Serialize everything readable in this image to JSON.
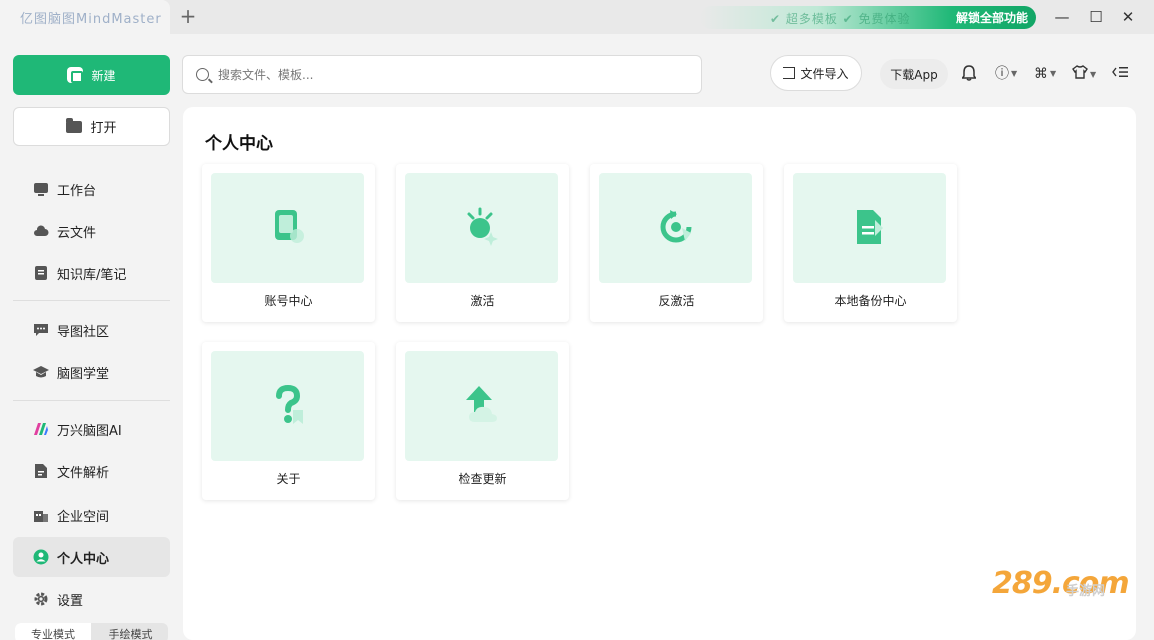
{
  "titlebar": {
    "tab_title": "亿图脑图MindMaster",
    "promo_faded": "✔ 超多模板 ✔ 免费体验",
    "promo_cta": "解锁全部功能",
    "add_tab": "+",
    "minimize": "—",
    "maximize": "☐",
    "close": "✕"
  },
  "sidebar": {
    "new_label": "新建",
    "open_label": "打开",
    "items": [
      {
        "label": "工作台",
        "icon": "workbench-icon"
      },
      {
        "label": "云文件",
        "icon": "cloud-icon"
      },
      {
        "label": "知识库/笔记",
        "icon": "notebook-icon"
      },
      {
        "label": "导图社区",
        "icon": "community-icon"
      },
      {
        "label": "脑图学堂",
        "icon": "graduation-cap-icon"
      },
      {
        "label": "万兴脑图AI",
        "icon": "ai-logo-icon"
      },
      {
        "label": "文件解析",
        "icon": "file-parse-icon"
      },
      {
        "label": "企业空间",
        "icon": "enterprise-icon"
      },
      {
        "label": "个人中心",
        "icon": "user-icon"
      },
      {
        "label": "设置",
        "icon": "gear-icon"
      }
    ],
    "mode_tabs": [
      "专业模式",
      "手绘模式"
    ]
  },
  "toolbar": {
    "search_placeholder": "搜索文件、模板...",
    "import_label": "文件导入",
    "download_label": "下载App"
  },
  "main": {
    "title": "个人中心",
    "cards": [
      {
        "label": "账号中心",
        "icon": "account-icon"
      },
      {
        "label": "激活",
        "icon": "activate-icon"
      },
      {
        "label": "反激活",
        "icon": "deactivate-icon"
      },
      {
        "label": "本地备份中心",
        "icon": "backup-icon"
      },
      {
        "label": "关于",
        "icon": "about-icon"
      },
      {
        "label": "检查更新",
        "icon": "update-icon"
      }
    ]
  },
  "watermark": {
    "main": "289.com",
    "sub": "手游网"
  },
  "colors": {
    "accent": "#1fb877",
    "card_bg": "#e5f7ef",
    "watermark": "#f4a63a"
  }
}
